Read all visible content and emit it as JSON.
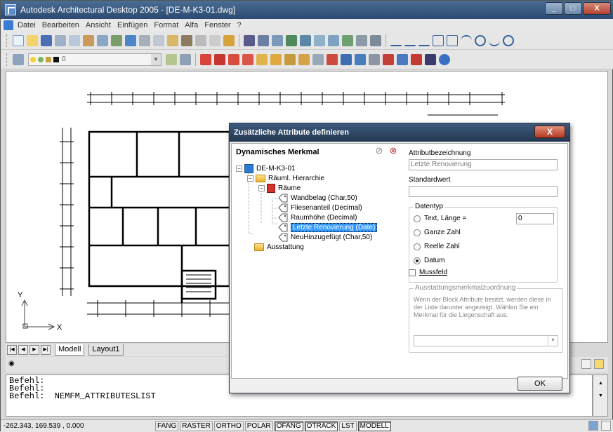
{
  "window": {
    "title": "Autodesk Architectural Desktop 2005 - [DE-M-K3-01.dwg]",
    "minimize": "_",
    "maximize": "□",
    "close": "X"
  },
  "menu": {
    "items": [
      "Datei",
      "Bearbeiten",
      "Ansicht",
      "Einfügen",
      "Format",
      "Alfa",
      "Fenster",
      "?"
    ]
  },
  "toolbar2": {
    "layer_value": "0"
  },
  "drawing": {
    "axis_y": "Y",
    "axis_x": "X"
  },
  "layout_tabs": {
    "nav": [
      "|◀",
      "◀",
      "▶",
      "▶|"
    ],
    "tabs": [
      "Modell",
      "Layout1"
    ]
  },
  "command": {
    "lines": [
      "Befehl:",
      "Befehl:",
      "Befehl:  NEMFM_ATTRIBUTESLIST"
    ]
  },
  "status": {
    "coords": "-262.343, 169.539 , 0.000",
    "buttons": [
      {
        "label": "FANG",
        "on": false
      },
      {
        "label": "RASTER",
        "on": false
      },
      {
        "label": "ORTHO",
        "on": false
      },
      {
        "label": "POLAR",
        "on": false
      },
      {
        "label": "OFANG",
        "on": true
      },
      {
        "label": "OTRACK",
        "on": true
      },
      {
        "label": "LST",
        "on": false
      },
      {
        "label": "MODELL",
        "on": true
      }
    ]
  },
  "dialog": {
    "title": "Zusätzliche Attribute definieren",
    "close": "X",
    "tree_header": "Dynamisches Merkmal",
    "tree": {
      "root": "DE-M-K3-01",
      "hierarchy": "Räuml. Hierarchie",
      "rooms": "Räume",
      "attributes": [
        "Wandbelag (Char,50)",
        "Fliesenanteil (Decimal)",
        "Raumhöhe (Decimal)",
        "Letzte Renovierung (Date)",
        "NeuHinzugefügt (Char,50)"
      ],
      "selected_index": 3,
      "equipment": "Ausstattung"
    },
    "attr_name_label": "Attributbezeichnung",
    "attr_name_value": "Letzte Renovierung",
    "default_label": "Standardwert",
    "default_value": "",
    "datatype_group": "Datentyp",
    "datatype_options": {
      "text": "Text, Länge =",
      "integer": "Ganze Zahl",
      "real": "Reelle Zahl",
      "date": "Datum"
    },
    "datatype_selected": "Datum",
    "text_length_value": "0",
    "required_label": "Mussfeld",
    "required_checked": false,
    "equip_group": "Ausstattungsmerkmalzuordnung",
    "equip_info": "Wenn der Block Attribute besitzt, werden diese in der Liste darunter angezeigt. Wählen Sie ein Merkmal für die Liegenschaft aus.",
    "equip_value": "",
    "ok": "OK"
  },
  "colors": {
    "title_bar": "#2c4a70",
    "dialog_title": "#23384f",
    "selection": "#3399ff",
    "close_button": "#b23a23"
  }
}
